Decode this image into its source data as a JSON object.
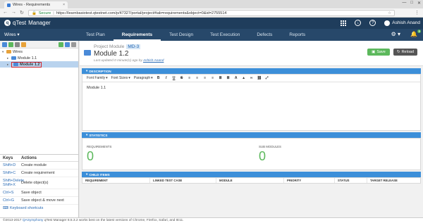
{
  "browser": {
    "tab_title": "Wires - Requirements",
    "tab_close": "×",
    "secure_label": "Secure",
    "url": "https://learnbasiotest.qtestnet.com/p/47327/portal/project#tab=requirements&object=0&id=2755514",
    "window_controls": [
      "—",
      "□",
      "✕"
    ],
    "nav": [
      "←",
      "→",
      "↻"
    ]
  },
  "app": {
    "logo_text": "qTest",
    "logo_suffix": "Manager",
    "user_name": "Ashish Anand",
    "bell_count": "8"
  },
  "nav": {
    "module_select": "Wires ▾",
    "tabs": [
      "Test Plan",
      "Requirements",
      "Test Design",
      "Test Execution",
      "Defects",
      "Reports"
    ],
    "active_tab": "Requirements"
  },
  "tree": {
    "nodes": [
      {
        "label": "Wires",
        "level": 0,
        "type": "project"
      },
      {
        "label": "Module 1.1",
        "level": 1,
        "type": "module"
      },
      {
        "label": "Module 1.2",
        "level": 1,
        "type": "module",
        "selected": true
      }
    ]
  },
  "keys": {
    "header_keys": "Keys",
    "header_actions": "Actions",
    "rows": [
      {
        "key": "Shift+D",
        "action": "Create module"
      },
      {
        "key": "Shift+C",
        "action": "Create requirement"
      },
      {
        "key": "Shift+Delete, Shift+X",
        "action": "Delete object(s)"
      },
      {
        "key": "Ctrl+S",
        "action": "Save object"
      },
      {
        "key": "Ctrl+G",
        "action": "Save object & move next"
      }
    ],
    "shortcuts_link": "Keyboard shortcuts"
  },
  "footer": {
    "copyright": "©2013-2017",
    "company": "QASymphony",
    "note": "qTest Manager 8.5.3.2 works best on the latest versions of Chrome, Firefox, Safari, and IE11."
  },
  "module": {
    "breadcrumb": "Project Module",
    "id": "MD-3",
    "title": "Module 1.2",
    "updated_prefix": "Last updated 0 minute(s) ago by",
    "updated_by": "Ashish Anand",
    "save_label": "Save",
    "reload_label": "Reload"
  },
  "description": {
    "section_title": "DESCRIPTION",
    "toolbar": {
      "font_family": "Font Family",
      "font_sizes": "Font Sizes",
      "paragraph": "Paragraph",
      "buttons": [
        "B",
        "I",
        "U",
        "S",
        "≡",
        "≡",
        "≡",
        "≡",
        "≣",
        "≣",
        "A",
        "▲",
        "∞",
        "⛓",
        "⤢"
      ]
    },
    "content": "Module 1.1"
  },
  "statistics": {
    "section_title": "STATISTICS",
    "requirements_label": "REQUIREMENTS",
    "requirements_value": "0",
    "submodules_label": "SUB MODULES",
    "submodules_value": "0"
  },
  "child_items": {
    "section_title": "CHILD ITEMS",
    "columns": [
      "REQUIREMENT",
      "LINKED TEST CASE",
      "MODULE",
      "PRIORITY",
      "STATUS",
      "TARGET RELEASE"
    ]
  },
  "colors": {
    "header": "#1f3d5c",
    "nav": "#27486a",
    "section_bar": "#3c8fd9",
    "save_green": "#5cb85c",
    "selection_box": "#d2232a"
  }
}
